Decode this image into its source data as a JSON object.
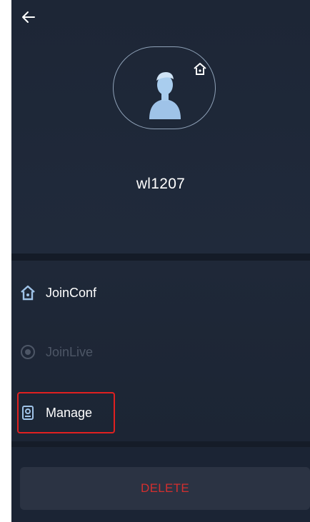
{
  "header": {
    "back_icon": "arrow-left-icon",
    "avatar_icon": "user-avatar-icon",
    "badge_icon": "home-icon",
    "user_name": "wl1207"
  },
  "menu": {
    "items": [
      {
        "label": "JoinConf",
        "icon": "home-icon",
        "enabled": true
      },
      {
        "label": "JoinLive",
        "icon": "radio-icon",
        "enabled": false
      },
      {
        "label": "Manage",
        "icon": "device-icon",
        "enabled": true,
        "highlighted": true
      }
    ]
  },
  "footer": {
    "delete_label": "DELETE"
  },
  "colors": {
    "background": "#1b2434",
    "accent_blue": "#9fc3e8",
    "delete_red": "#d32f2f",
    "highlight_red": "#e02020",
    "disabled_text": "#4d5666"
  }
}
